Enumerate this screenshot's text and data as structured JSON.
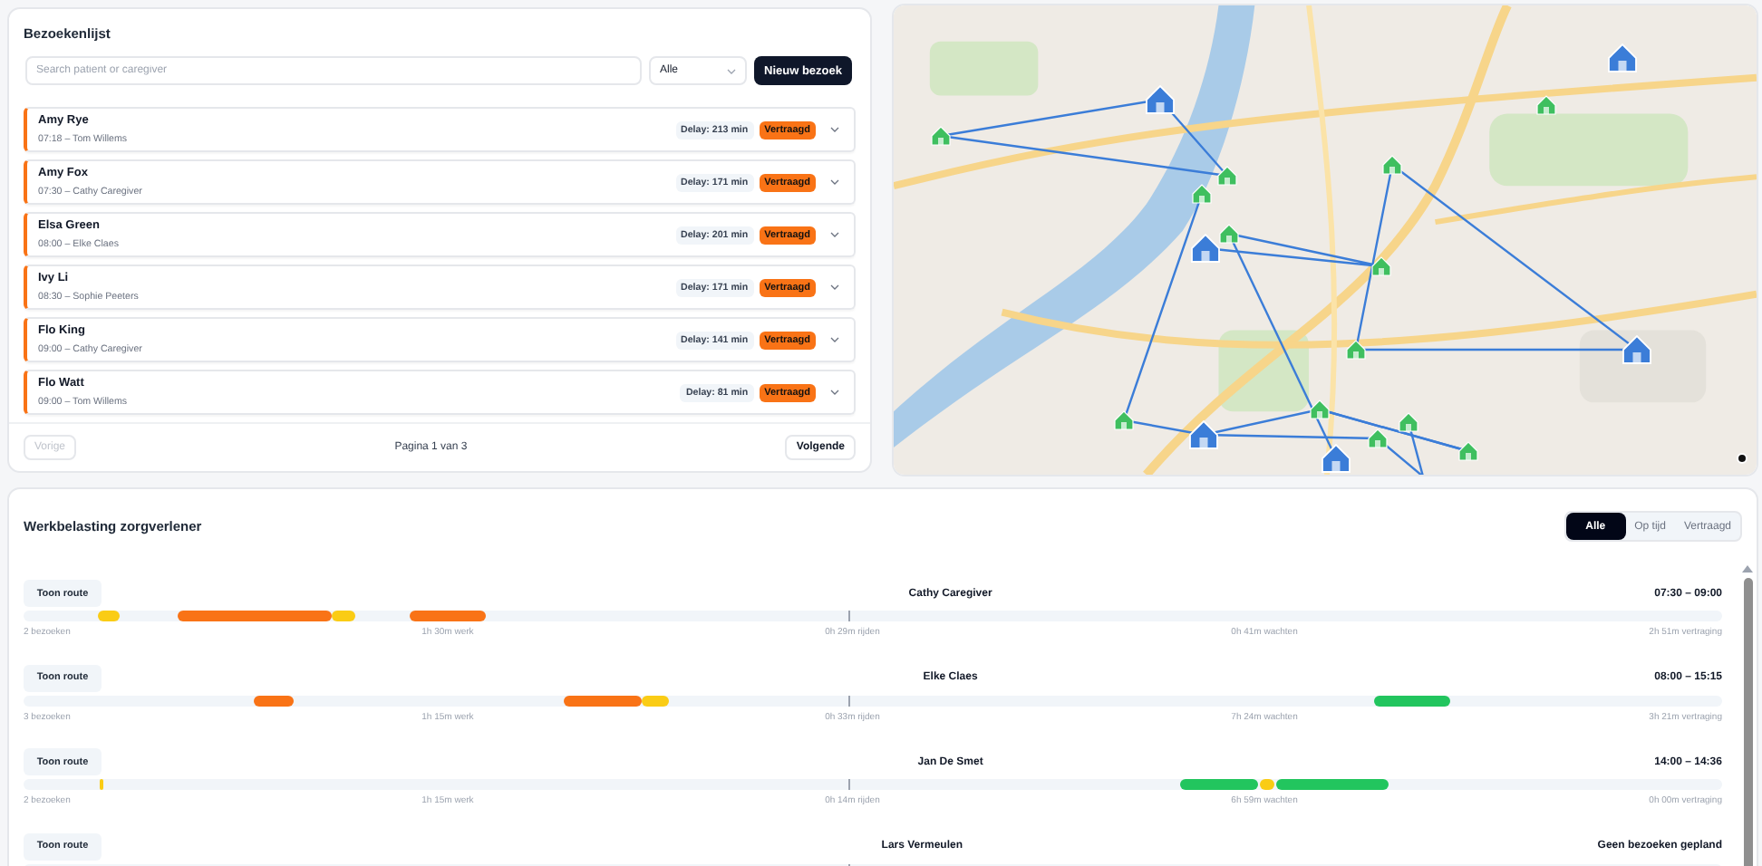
{
  "visit_list": {
    "title": "Bezoekenlijst",
    "search": {
      "placeholder": "Search patient or caregiver"
    },
    "filter": {
      "value": "Alle"
    },
    "new_button": "Nieuw bezoek",
    "visits": [
      {
        "patient": "Amy Rye",
        "detail": "07:18 – Tom Willems",
        "delay": "Delay: 213 min",
        "status": "Vertraagd",
        "kind": "late"
      },
      {
        "patient": "Amy Fox",
        "detail": "07:30 – Cathy Caregiver",
        "delay": "Delay: 171 min",
        "status": "Vertraagd",
        "kind": "late"
      },
      {
        "patient": "Elsa Green",
        "detail": "08:00 – Elke Claes",
        "delay": "Delay: 201 min",
        "status": "Vertraagd",
        "kind": "late"
      },
      {
        "patient": "Ivy Li",
        "detail": "08:30 – Sophie Peeters",
        "delay": "Delay: 171 min",
        "status": "Vertraagd",
        "kind": "late"
      },
      {
        "patient": "Flo King",
        "detail": "09:00 – Cathy Caregiver",
        "delay": "Delay: 141 min",
        "status": "Vertraagd",
        "kind": "late"
      },
      {
        "patient": "Flo Watt",
        "detail": "09:00 – Tom Willems",
        "delay": "Delay: 81 min",
        "status": "Vertraagd",
        "kind": "late"
      }
    ],
    "pagination": {
      "previous": {
        "label": "Vorige",
        "disabled": true
      },
      "page": "Pagina 1 van 3",
      "next": {
        "label": "Volgende",
        "disabled": false
      }
    }
  },
  "workload": {
    "title": "Werkbelasting zorgverlener",
    "filters": [
      {
        "label": "Alle",
        "selected": true
      },
      {
        "label": "Op tijd",
        "selected": false
      },
      {
        "label": "Vertraagd",
        "selected": false
      }
    ],
    "caregivers": [
      {
        "button": "Toon route",
        "name": "Cathy Caregiver",
        "time_range": "07:30 – 09:00",
        "stats": [
          "2 bezoeken",
          "1h 30m werk",
          "0h 29m rijden",
          "0h 41m wachten",
          "2h 51m vertraging"
        ]
      },
      {
        "button": "Toon route",
        "name": "Elke Claes",
        "time_range": "08:00 – 15:15",
        "stats": [
          "3 bezoeken",
          "1h 15m werk",
          "0h 33m rijden",
          "7h 24m wachten",
          "3h 21m vertraging"
        ]
      },
      {
        "button": "Toon route",
        "name": "Jan De Smet",
        "time_range": "14:00 – 14:36",
        "stats": [
          "2 bezoeken",
          "1h 15m werk",
          "0h 14m rijden",
          "6h 59m wachten",
          "0h 00m vertraging"
        ]
      },
      {
        "button": "Toon route",
        "name": "Lars Vermeulen",
        "time_range": "Geen bezoeken gepland"
      }
    ]
  }
}
